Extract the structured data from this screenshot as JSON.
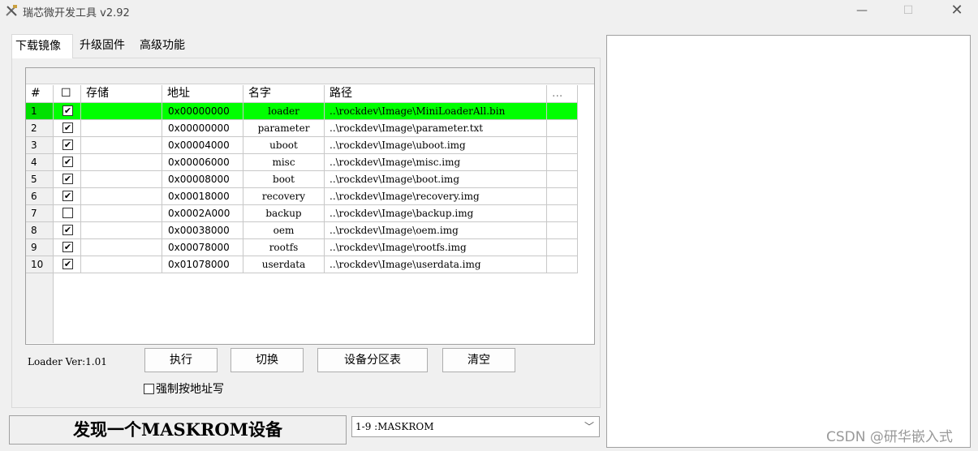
{
  "window": {
    "title": "瑞芯微开发工具 v2.92",
    "icon": "tools-icon",
    "controls": {
      "minimize": "—",
      "maximize": "☐",
      "close": "✕"
    }
  },
  "tabs": [
    "下载镜像",
    "升级固件",
    "高级功能"
  ],
  "table": {
    "headers": [
      "#",
      "☐",
      "存储",
      "地址",
      "名字",
      "路径",
      "..."
    ],
    "rows": [
      {
        "num": "1",
        "checked": "✔",
        "store": "",
        "addr": "0x00000000",
        "name": "loader",
        "path": "..\\rockdev\\Image\\MiniLoaderAll.bin"
      },
      {
        "num": "2",
        "checked": "✔",
        "store": "",
        "addr": "0x00000000",
        "name": "parameter",
        "path": "..\\rockdev\\Image\\parameter.txt"
      },
      {
        "num": "3",
        "checked": "✔",
        "store": "",
        "addr": "0x00004000",
        "name": "uboot",
        "path": "..\\rockdev\\Image\\uboot.img"
      },
      {
        "num": "4",
        "checked": "✔",
        "store": "",
        "addr": "0x00006000",
        "name": "misc",
        "path": "..\\rockdev\\Image\\misc.img"
      },
      {
        "num": "5",
        "checked": "✔",
        "store": "",
        "addr": "0x00008000",
        "name": "boot",
        "path": "..\\rockdev\\Image\\boot.img"
      },
      {
        "num": "6",
        "checked": "✔",
        "store": "",
        "addr": "0x00018000",
        "name": "recovery",
        "path": "..\\rockdev\\Image\\recovery.img"
      },
      {
        "num": "7",
        "checked": "",
        "store": "",
        "addr": "0x0002A000",
        "name": "backup",
        "path": "..\\rockdev\\Image\\backup.img"
      },
      {
        "num": "8",
        "checked": "✔",
        "store": "",
        "addr": "0x00038000",
        "name": "oem",
        "path": "..\\rockdev\\Image\\oem.img"
      },
      {
        "num": "9",
        "checked": "✔",
        "store": "",
        "addr": "0x00078000",
        "name": "rootfs",
        "path": "..\\rockdev\\Image\\rootfs.img"
      },
      {
        "num": "10",
        "checked": "✔",
        "store": "",
        "addr": "0x01078000",
        "name": "userdata",
        "path": "..\\rockdev\\Image\\userdata.img"
      }
    ],
    "active_row_color": "#00ff00"
  },
  "loader_ver": "Loader Ver:1.01",
  "buttons": {
    "exec": "执行",
    "switch": "切换",
    "partition": "设备分区表",
    "clear": "清空"
  },
  "force_write_label": "强制按地址写",
  "status": "发现一个MASKROM设备",
  "device_select": {
    "value": "1-9 :MASKROM",
    "arrow": "﹀"
  },
  "watermark": "CSDN @研华嵌入式"
}
